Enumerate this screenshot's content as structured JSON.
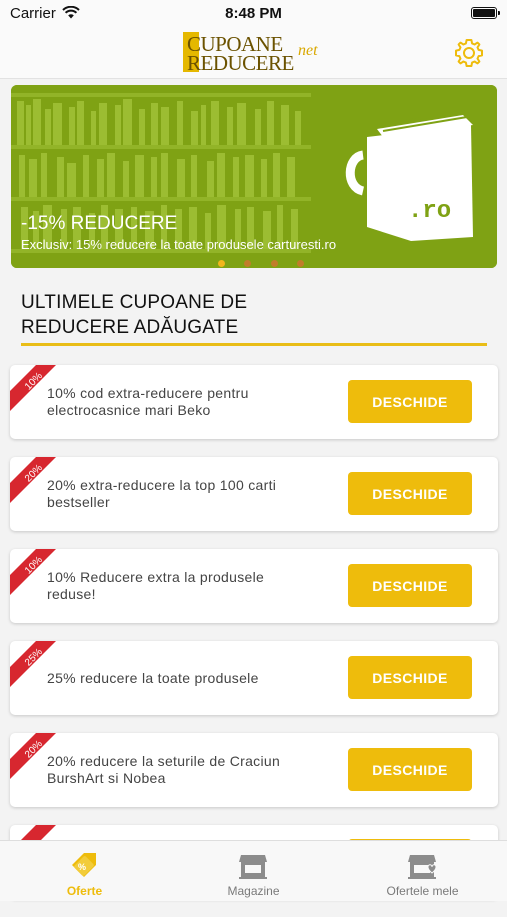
{
  "status_bar": {
    "carrier": "Carrier",
    "time": "8:48 PM"
  },
  "header": {
    "logo_line1": "CUPOANE",
    "logo_line2": "REDUCERE",
    "logo_suffix": "net"
  },
  "banner": {
    "title": "-15% REDUCERE",
    "subtitle": "Exclusiv: 15% reducere la toate produsele carturesti.ro",
    "mug_text": ".ro",
    "slides": 4,
    "active_slide": 1
  },
  "section": {
    "title": "ULTIMELE CUPOANE DE REDUCERE ADĂUGATE"
  },
  "coupons": [
    {
      "badge": "10%",
      "text": "10% cod extra-reducere pentru electrocasnice mari Beko",
      "button": "DESCHIDE"
    },
    {
      "badge": "20%",
      "text": "20% extra-reducere la top 100 carti bestseller",
      "button": "DESCHIDE"
    },
    {
      "badge": "10%",
      "text": "10% Reducere extra la produsele reduse!",
      "button": "DESCHIDE"
    },
    {
      "badge": "25%",
      "text": "25% reducere la toate produsele",
      "button": "DESCHIDE"
    },
    {
      "badge": "20%",
      "text": "20% reducere la seturile de Craciun BurshArt si Nobea",
      "button": "DESCHIDE"
    }
  ],
  "tabs": [
    {
      "label": "Oferte",
      "icon": "coupon-tag-icon",
      "active": true
    },
    {
      "label": "Magazine",
      "icon": "store-icon",
      "active": false
    },
    {
      "label": "Ofertele mele",
      "icon": "favorite-store-icon",
      "active": false
    }
  ],
  "colors": {
    "accent": "#eebc0c",
    "ribbon": "#d7272f",
    "banner": "#7fa214",
    "underline": "#e9bd17"
  }
}
